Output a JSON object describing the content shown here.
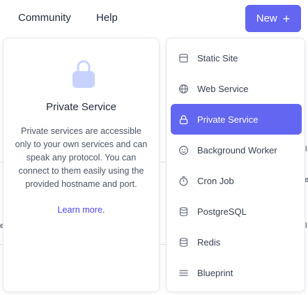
{
  "nav": {
    "community": "Community",
    "help": "Help",
    "new_label": "New",
    "new_plus": "+"
  },
  "info": {
    "title": "Private Service",
    "description": "Private services are accessible only to your own services and can speak any protocol. You can connect to them easily using the provided hostname and port.",
    "link": "Learn more."
  },
  "menu": {
    "active_index": 2,
    "items": [
      {
        "label": "Static Site",
        "icon": "static-site-icon"
      },
      {
        "label": "Web Service",
        "icon": "globe-icon"
      },
      {
        "label": "Private Service",
        "icon": "lock-icon"
      },
      {
        "label": "Background Worker",
        "icon": "worker-icon"
      },
      {
        "label": "Cron Job",
        "icon": "stopwatch-icon"
      },
      {
        "label": "PostgreSQL",
        "icon": "database-icon"
      },
      {
        "label": "Redis",
        "icon": "database-icon"
      },
      {
        "label": "Blueprint",
        "icon": "blueprint-icon"
      }
    ]
  },
  "background": {
    "fragments": [
      "l",
      "e",
      "l",
      "e"
    ]
  },
  "colors": {
    "accent": "#6366f1",
    "link": "#4f46e5",
    "lock_icon": "#c7d2fe"
  }
}
